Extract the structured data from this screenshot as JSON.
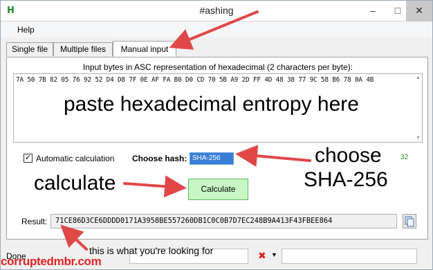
{
  "window": {
    "title": "#ashing",
    "app_icon_letter": "H",
    "minimize_glyph": "–",
    "maximize_glyph": "□",
    "close_glyph": "✕"
  },
  "menu": {
    "help": "Help"
  },
  "tabs": [
    {
      "label": "Single file",
      "selected": false
    },
    {
      "label": "Multiple files",
      "selected": false
    },
    {
      "label": "Manual input",
      "selected": true
    }
  ],
  "manual_input": {
    "caption": "Input bytes in ASC representation of hexadecimal (2 characters per byte):",
    "hex_value": "7A 50 7B 82 05 76 92 52 D4 D8 7F 0E AF FA B0 D0 CD 70 5B A9 2D FF 4D 48 38 77 9C 58 B6 78 0A 4B",
    "automatic_calculation_label": "Automatic calculation",
    "automatic_calculation_checked": true,
    "choose_hash_label": "Choose hash:",
    "hash_selected": "SHA-256",
    "byte_count": "32",
    "calculate_label": "Calculate",
    "result_label": "Result:",
    "result_value": "71CE86D3CE6DDDD0171A3958BE557260DB1C0C0B7D7EC248B9A413F43FBEE864"
  },
  "status": {
    "text": "Done"
  },
  "annotations": {
    "paste": "paste hexadecimal entropy here",
    "choose_line1": "choose",
    "choose_line2": "SHA-256",
    "calculate": "calculate",
    "looking_for": "this is what you're looking for"
  },
  "watermark": "corruptedmbr.com",
  "colors": {
    "accent_green": "#1e8a2c",
    "calculate_button": "#c8f7c5",
    "hash_select": "#3a7fd6",
    "arrow_red": "#e04848",
    "watermark_red": "#e32222"
  }
}
